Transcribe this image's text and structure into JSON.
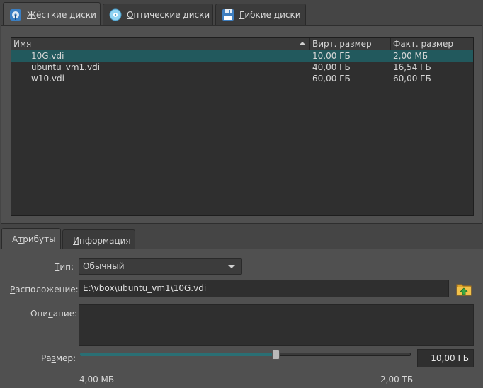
{
  "tabs": [
    {
      "label": "Жёсткие диски",
      "accel": "Ж",
      "icon": "hard-disk-icon",
      "active": true
    },
    {
      "label": "Оптические диски",
      "accel": "О",
      "icon": "optical-disc-icon",
      "active": false
    },
    {
      "label": "Гибкие диски",
      "accel": "Г",
      "icon": "floppy-disk-icon",
      "active": false
    }
  ],
  "table": {
    "columns": [
      "Имя",
      "Вирт. размер",
      "Факт. размер"
    ],
    "rows": [
      {
        "name": "10G.vdi",
        "virtual": "10,00 ГБ",
        "actual": "2,00 МБ",
        "selected": true
      },
      {
        "name": "ubuntu_vm1.vdi",
        "virtual": "40,00 ГБ",
        "actual": "16,54 ГБ",
        "selected": false
      },
      {
        "name": "w10.vdi",
        "virtual": "60,00 ГБ",
        "actual": "60,00 ГБ",
        "selected": false
      }
    ]
  },
  "details_tabs": [
    {
      "label": "Атрибуты",
      "accel": "т",
      "active": true
    },
    {
      "label": "Информация",
      "accel": "И",
      "active": false
    }
  ],
  "attributes": {
    "type_label": "Тип:",
    "type_value": "Обычный",
    "location_label": "Расположение:",
    "location_value": "E:\\vbox\\ubuntu_vm1\\10G.vdi",
    "description_label": "Описание:",
    "description_value": "",
    "size_label": "Размер:",
    "size_value": "10,00 ГБ",
    "size_min": "4,00 МБ",
    "size_max": "2,00 ТБ",
    "slider_fraction": 0.59
  },
  "colors": {
    "selection": "#22595d",
    "accent": "#2a6f74",
    "background": "#454545"
  }
}
